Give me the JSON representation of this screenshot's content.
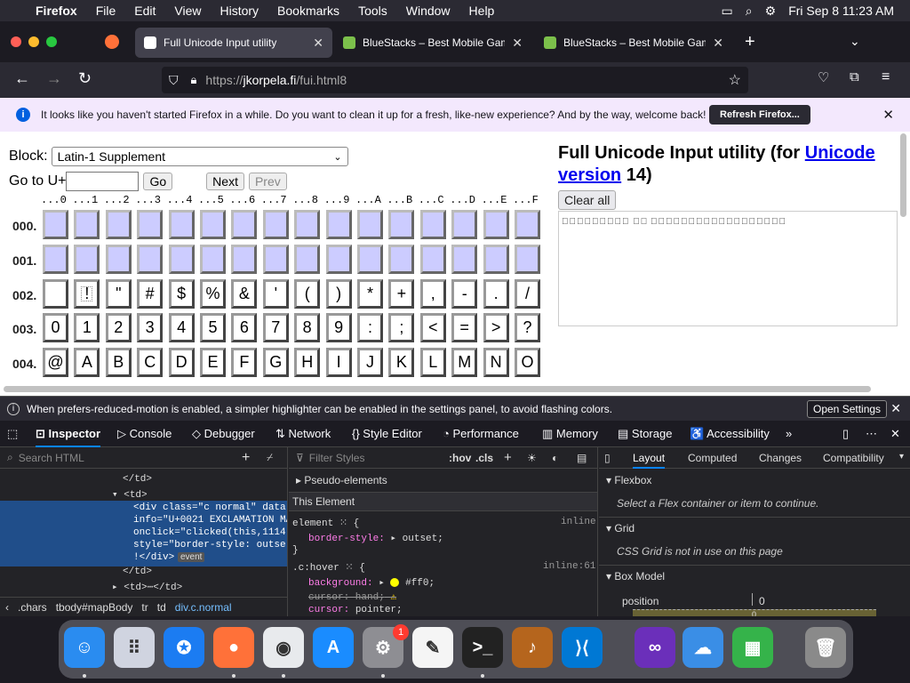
{
  "menubar": {
    "app": "Firefox",
    "items": [
      "File",
      "Edit",
      "View",
      "History",
      "Bookmarks",
      "Tools",
      "Window",
      "Help"
    ],
    "clock": "Fri Sep 8  11:23 AM"
  },
  "tabs": [
    {
      "title": "Full Unicode Input utility",
      "active": true,
      "color": "#ffffff"
    },
    {
      "title": "BlueStacks – Best Mobile Gaming",
      "active": false,
      "color": "#7cc04b"
    },
    {
      "title": "BlueStacks – Best Mobile Gaming",
      "active": false,
      "color": "#7cc04b"
    }
  ],
  "url": {
    "prefix": "https://",
    "domain": "jkorpela.fi",
    "path": "/fui.html8"
  },
  "notification": {
    "text": "It looks like you haven't started Firefox in a while. Do you want to clean it up for a fresh, like-new experience? And by the way, welcome back!",
    "button": "Refresh Firefox..."
  },
  "page": {
    "block_label": "Block:",
    "block_value": "Latin-1 Supplement",
    "goto_label": "Go to U+",
    "go": "Go",
    "next": "Next",
    "prev": "Prev",
    "col_headers": [
      "...0",
      "...1",
      "...2",
      "...3",
      "...4",
      "...5",
      "...6",
      "...7",
      "...8",
      "...9",
      "...A",
      "...B",
      "...C",
      "...D",
      "...E",
      "...F"
    ],
    "rows": [
      {
        "label": "000.",
        "cells": [
          "",
          "",
          "",
          "",
          "",
          "",
          "",
          "",
          "",
          "",
          "",
          "",
          "",
          "",
          "",
          ""
        ],
        "ctrl": true
      },
      {
        "label": "001.",
        "cells": [
          "",
          "",
          "",
          "",
          "",
          "",
          "",
          "",
          "",
          "",
          "",
          "",
          "",
          "",
          "",
          ""
        ],
        "ctrl": true
      },
      {
        "label": "002.",
        "cells": [
          " ",
          "!",
          "\"",
          "#",
          "$",
          "%",
          "&",
          "'",
          "(",
          ")",
          "*",
          "+",
          ",",
          "-",
          ".",
          "/"
        ],
        "ctrl": false
      },
      {
        "label": "003.",
        "cells": [
          "0",
          "1",
          "2",
          "3",
          "4",
          "5",
          "6",
          "7",
          "8",
          "9",
          ":",
          ";",
          "<",
          "=",
          ">",
          "?"
        ],
        "ctrl": false
      },
      {
        "label": "004.",
        "cells": [
          "@",
          "A",
          "B",
          "C",
          "D",
          "E",
          "F",
          "G",
          "H",
          "I",
          "J",
          "K",
          "L",
          "M",
          "N",
          "O"
        ],
        "ctrl": false
      }
    ],
    "title_pre": "Full Unicode Input utility (for ",
    "title_link": "Unicode version",
    "title_post": " 14)",
    "clear": "Clear all",
    "output": "\u0000\u0001\u0002\u0003\u0004\u0005\u0006\u0007\b\t\n\u000b\f\r\u000e\u000f\u0010\u0011\u0012\u0013\u0014\u0015\u0016\u0017\u0018\u0019\u001a\u001b\u001c\u001d\u001e\u001f"
  },
  "devtools": {
    "info": "When prefers-reduced-motion is enabled, a simpler highlighter can be enabled in the settings panel, to avoid flashing colors.",
    "info_button": "Open Settings",
    "tabs": [
      "Inspector",
      "Console",
      "Debugger",
      "Network",
      "Style Editor",
      "Performance",
      "Memory",
      "Storage",
      "Accessibility"
    ],
    "search_html": "Search HTML",
    "html_lines": [
      "</td>",
      "▾ <td>",
      "<div class=\"c normal\" data-",
      "info=\"U+0021 EXCLAMATION MA",
      "onclick=\"clicked(this,1114",
      "style=\"border-style: outse",
      "!</div>",
      "</td>",
      "▸ <td>⋯</td>"
    ],
    "event_badge": "event",
    "breadcrumb": [
      "‹",
      ".chars",
      "tbody#mapBody",
      "tr",
      "td",
      "div.c.normal"
    ],
    "filter_styles": "Filter Styles",
    "hov": ":hov",
    ".cls": ".cls",
    "rules": {
      "pseudo": "Pseudo-elements",
      "this_element": "This Element",
      "element_sel": "element",
      "inline": "inline",
      "border_style_prop": "border-style:",
      "border_style_val": "outset;",
      "hover_sel": ".c:hover",
      "hover_src": "inline:61",
      "bg_prop": "background:",
      "bg_val": "#ff0;",
      "cursor1": "cursor: hand;",
      "cursor2_prop": "cursor:",
      "cursor2_val": "pointer;"
    },
    "layout_tabs": [
      "Layout",
      "Computed",
      "Changes",
      "Compatibility"
    ],
    "flexbox": "Flexbox",
    "flex_msg": "Select a Flex container or item to continue.",
    "grid": "Grid",
    "grid_msg": "CSS Grid is not in use on this page",
    "boxmodel": "Box Model",
    "position": "position",
    "pos_val": "0",
    "margin_val": "0"
  },
  "dock": [
    "Finder",
    "Launchpad",
    "Safari",
    "Firefox",
    "Chrome",
    "App Store",
    "System Settings",
    "TextEdit",
    "Terminal",
    "GarageBand",
    "VS Code",
    "Visual Studio",
    "Weather",
    "BlueStacks",
    "Trash"
  ],
  "badge": "1"
}
